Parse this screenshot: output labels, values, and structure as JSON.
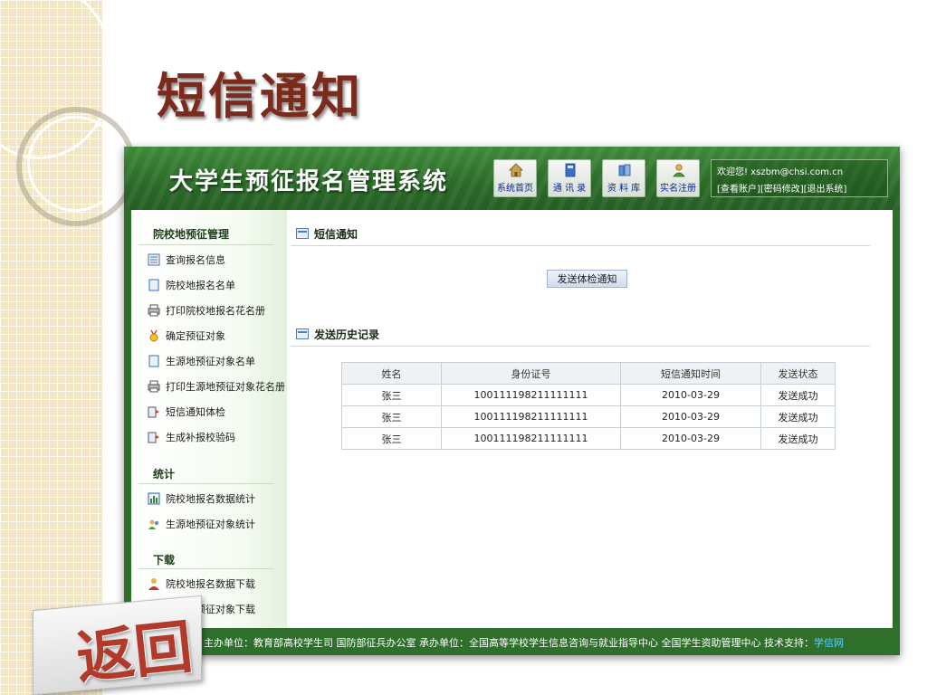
{
  "slide": {
    "title": "短信通知"
  },
  "app": {
    "title": "大学生预征报名管理系统",
    "nav": [
      {
        "label": "系统首页",
        "icon": "home-icon"
      },
      {
        "label": "通 讯 录",
        "icon": "address-book-icon"
      },
      {
        "label": "资 料 库",
        "icon": "library-icon"
      },
      {
        "label": "实名注册",
        "icon": "user-register-icon"
      }
    ],
    "user": {
      "welcome": "欢迎您! xszbm@chsi.com.cn",
      "view_account": "[查看账户]",
      "change_password": "[密码修改]",
      "logout": "[退出系统]"
    }
  },
  "sidebar": {
    "section1": "院校地预征管理",
    "items1": [
      "查询报名信息",
      "院校地报名名单",
      "打印院校地报名花名册",
      "确定预征对象",
      "生源地预征对象名单",
      "打印生源地预征对象花名册",
      "短信通知体检",
      "生成补报校验码"
    ],
    "section2": "统计",
    "items2": [
      "院校地报名数据统计",
      "生源地预征对象统计"
    ],
    "section3": "下载",
    "items3": [
      "院校地报名数据下载",
      "生源地预征对象下载"
    ]
  },
  "main": {
    "section1_title": "短信通知",
    "send_button": "发送体检通知",
    "section2_title": "发送历史记录",
    "table": {
      "headers": [
        "姓名",
        "身份证号",
        "短信通知时间",
        "发送状态"
      ],
      "rows": [
        [
          "张三",
          "100111198211111111",
          "2010-03-29",
          "发送成功"
        ],
        [
          "张三",
          "100111198211111111",
          "2010-03-29",
          "发送成功"
        ],
        [
          "张三",
          "100111198211111111",
          "2010-03-29",
          "发送成功"
        ]
      ]
    }
  },
  "footer": {
    "text": "主办单位：教育部高校学生司  国防部征兵办公室   承办单位：全国高等学校学生信息咨询与就业指导中心  全国学生资助管理中心   技术支持：",
    "link": "学信网"
  },
  "return_button": "返回",
  "colors": {
    "header_green": "#2f6f2c",
    "title_red": "#7b2a1c",
    "link_blue": "#0d2a9b"
  }
}
